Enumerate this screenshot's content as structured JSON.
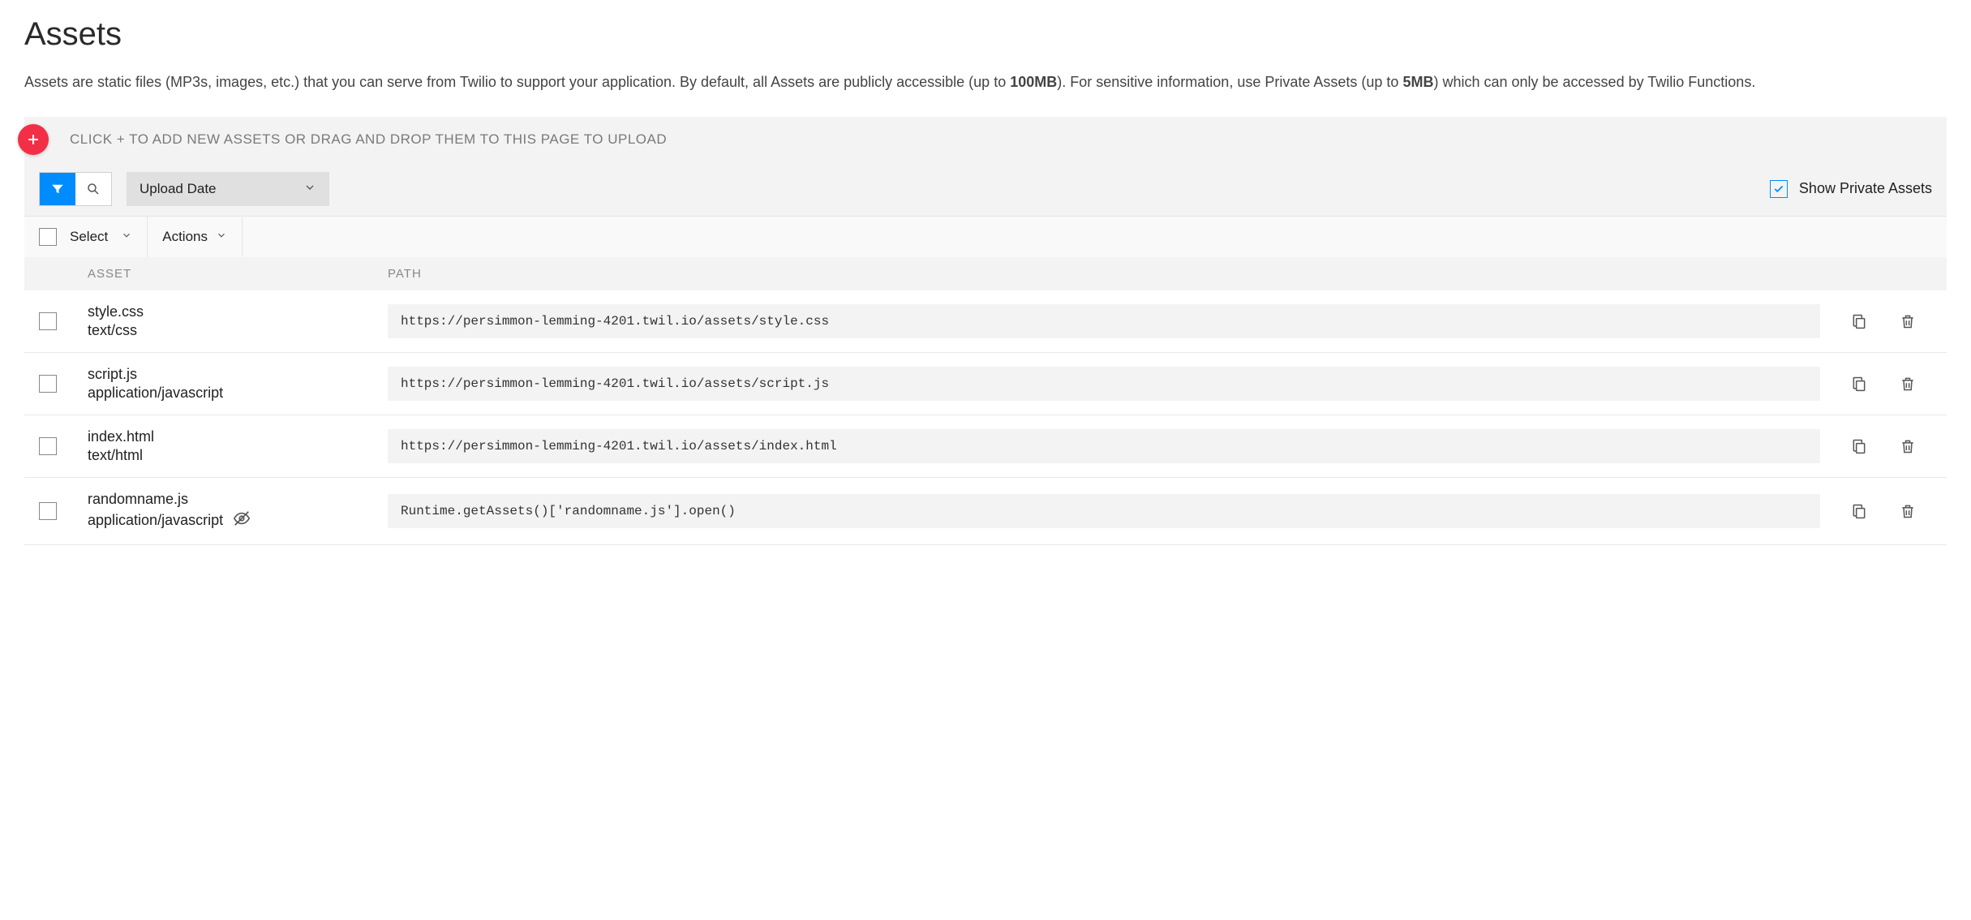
{
  "page": {
    "title": "Assets",
    "description_prefix": "Assets are static files (MP3s, images, etc.) that you can serve from Twilio to support your application. By default, all Assets are publicly accessible (up to ",
    "limit_public": "100MB",
    "description_mid": "). For sensitive information, use Private Assets (up to ",
    "limit_private": "5MB",
    "description_suffix": ") which can only be accessed by Twilio Functions."
  },
  "upload": {
    "hint": "CLICK + TO ADD NEW ASSETS OR DRAG AND DROP THEM TO THIS PAGE TO UPLOAD"
  },
  "filter": {
    "sort_label": "Upload Date",
    "show_private_label": "Show Private Assets",
    "show_private_checked": true
  },
  "actions": {
    "select_label": "Select",
    "actions_label": "Actions"
  },
  "headers": {
    "asset": "ASSET",
    "path": "PATH"
  },
  "assets": [
    {
      "name": "style.css",
      "type": "text/css",
      "path": "https://persimmon-lemming-4201.twil.io/assets/style.css",
      "private": false
    },
    {
      "name": "script.js",
      "type": "application/javascript",
      "path": "https://persimmon-lemming-4201.twil.io/assets/script.js",
      "private": false
    },
    {
      "name": "index.html",
      "type": "text/html",
      "path": "https://persimmon-lemming-4201.twil.io/assets/index.html",
      "private": false
    },
    {
      "name": "randomname.js",
      "type": "application/javascript",
      "path": "Runtime.getAssets()['randomname.js'].open()",
      "private": true
    }
  ]
}
